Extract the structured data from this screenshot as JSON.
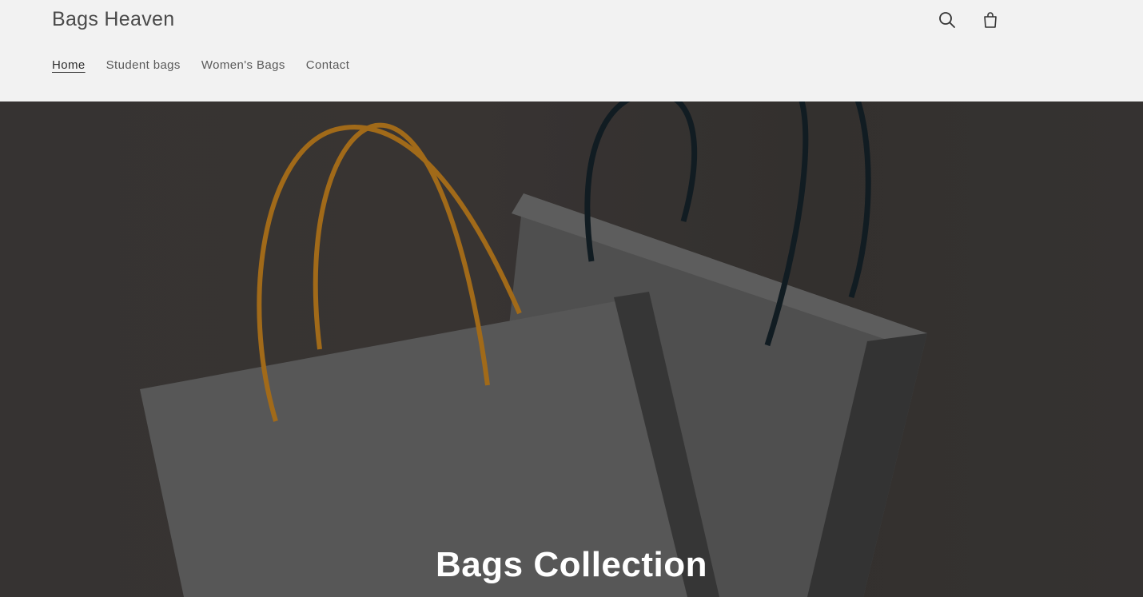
{
  "header": {
    "brand": "Bags Heaven",
    "nav": [
      {
        "label": "Home",
        "active": true
      },
      {
        "label": "Student bags",
        "active": false
      },
      {
        "label": "Women's Bags",
        "active": false
      },
      {
        "label": "Contact",
        "active": false
      }
    ],
    "icons": [
      "search-icon",
      "cart-icon"
    ]
  },
  "hero": {
    "title": "Bags Collection",
    "image": "two shopping bags with rope handles"
  },
  "colors": {
    "header_bg": "#f2f2f2",
    "hero_bg": "#3e3b39",
    "handle_orange": "#b8791d",
    "handle_dark": "#142027"
  }
}
